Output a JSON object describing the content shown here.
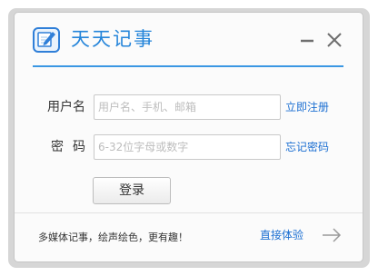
{
  "app": {
    "title": "天天记事",
    "icon": "notebook-pen-icon",
    "accent_color": "#2585da"
  },
  "window_controls": {
    "minimize_icon": "minimize-icon",
    "close_icon": "close-icon"
  },
  "form": {
    "username": {
      "label": "用户名",
      "placeholder": "用户名、手机、邮箱",
      "value": "",
      "link": "立即注册"
    },
    "password": {
      "label": "密码",
      "placeholder": "6-32位字母或数字",
      "value": "",
      "link": "忘记密码"
    },
    "login_label": "登录"
  },
  "footer": {
    "tagline": "多媒体记事，绘声绘色，更有趣！",
    "try_link": "直接体验",
    "arrow_icon": "arrow-right-icon",
    "link_color": "#1c6fd2"
  }
}
